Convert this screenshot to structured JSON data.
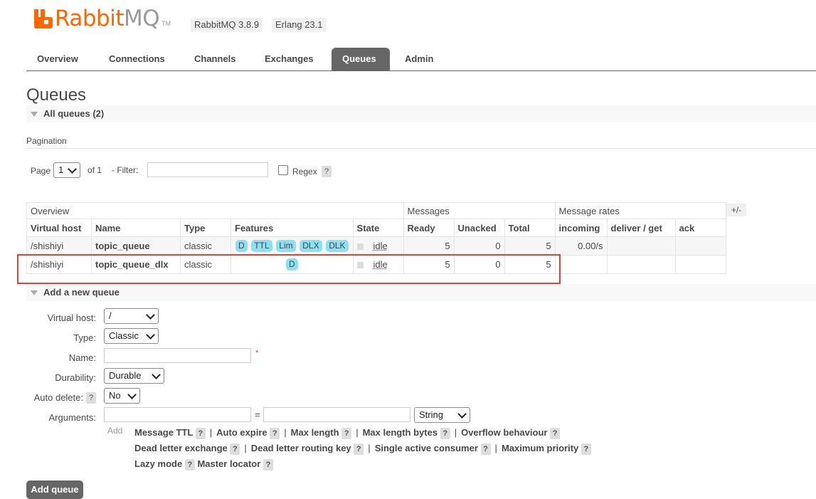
{
  "header": {
    "logo_rabbit": "Rabbit",
    "logo_mq": "MQ",
    "logo_tm": "TM",
    "version_rabbitmq": "RabbitMQ 3.8.9",
    "version_erlang": "Erlang 23.1"
  },
  "nav": {
    "tabs": [
      "Overview",
      "Connections",
      "Channels",
      "Exchanges",
      "Queues",
      "Admin"
    ],
    "active": "Queues"
  },
  "page_title": "Queues",
  "all_queues": {
    "label": "All queues (2)"
  },
  "pagination": {
    "section_label": "Pagination",
    "page_label": "Page",
    "page_value": "1",
    "of_label": "of 1",
    "filter_label": "- Filter:",
    "filter_value": "",
    "regex_label": "Regex",
    "help": "?"
  },
  "table": {
    "groups": {
      "overview": "Overview",
      "messages": "Messages",
      "rates": "Message rates"
    },
    "toggle_columns": "+/-",
    "headers": [
      "Virtual host",
      "Name",
      "Type",
      "Features",
      "State",
      "Ready",
      "Unacked",
      "Total",
      "incoming",
      "deliver / get",
      "ack"
    ],
    "rows": [
      {
        "vhost": "/shishiyi",
        "name": "topic_queue",
        "type": "classic",
        "features": [
          "D",
          "TTL",
          "Lim",
          "DLX",
          "DLK"
        ],
        "state": "idle",
        "ready": "5",
        "unacked": "0",
        "total": "5",
        "incoming": "0.00/s",
        "deliver_get": "",
        "ack": ""
      },
      {
        "vhost": "/shishiyi",
        "name": "topic_queue_dlx",
        "type": "classic",
        "features": [
          "D"
        ],
        "state": "idle",
        "ready": "5",
        "unacked": "0",
        "total": "5",
        "incoming": "",
        "deliver_get": "",
        "ack": ""
      }
    ]
  },
  "add_queue": {
    "section_label": "Add a new queue",
    "vhost_label": "Virtual host:",
    "vhost_value": "/",
    "type_label": "Type:",
    "type_value": "Classic",
    "name_label": "Name:",
    "name_required": "*",
    "durability_label": "Durability:",
    "durability_value": "Durable",
    "autodelete_label": "Auto delete:",
    "autodelete_value": "No",
    "arguments_label": "Arguments:",
    "arg_eq": "=",
    "arg_type": "String",
    "add_label": "Add",
    "links_row1": [
      "Message TTL",
      "Auto expire",
      "Max length",
      "Max length bytes",
      "Overflow behaviour"
    ],
    "links_row2": [
      "Dead letter exchange",
      "Dead letter routing key",
      "Single active consumer",
      "Maximum priority"
    ],
    "links_row3": [
      "Lazy mode",
      "Master locator"
    ],
    "submit": "Add queue"
  }
}
